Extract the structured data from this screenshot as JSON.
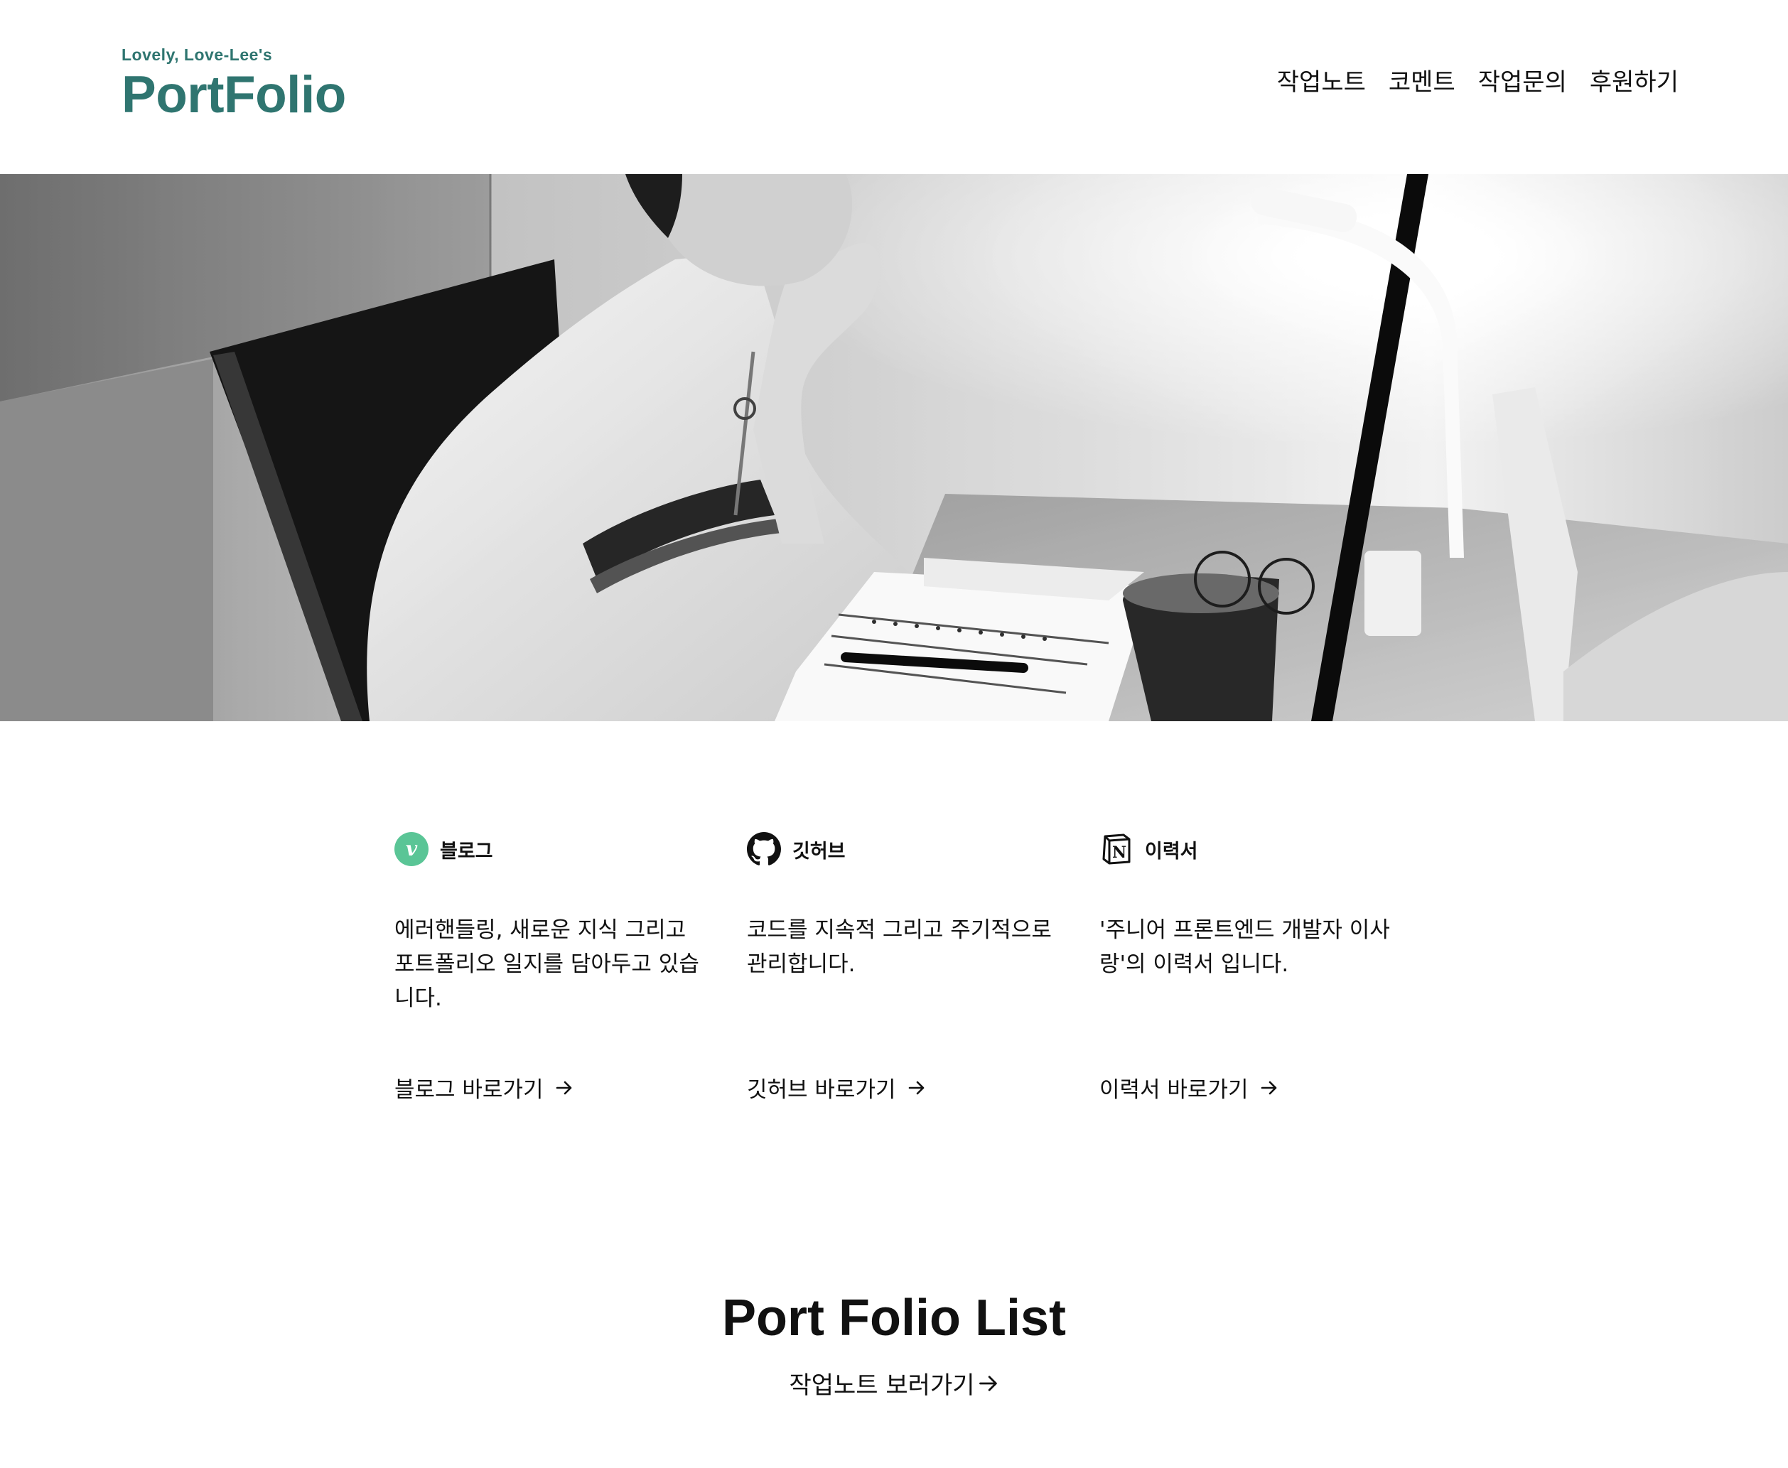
{
  "brand": {
    "tagline": "Lovely, Love-Lee's",
    "title": "PortFolio",
    "color": "#2f7570"
  },
  "nav": {
    "items": [
      {
        "label": "작업노트"
      },
      {
        "label": "코멘트"
      },
      {
        "label": "작업문의"
      },
      {
        "label": "후원하기"
      }
    ]
  },
  "cards": [
    {
      "icon": "velog-icon",
      "title": "블로그",
      "description": "에러핸들링, 새로운 지식 그리고 포트폴리오 일지를 담아두고 있습니다.",
      "link_label": "블로그 바로가기"
    },
    {
      "icon": "github-icon",
      "title": "깃허브",
      "description": "코드를 지속적 그리고 주기적으로 관리합니다.",
      "link_label": "깃허브 바로가기"
    },
    {
      "icon": "notion-icon",
      "title": "이력서",
      "description": "'주니어 프론트엔드 개발자 이사랑'의 이력서 입니다.",
      "link_label": "이력서 바로가기"
    }
  ],
  "portfolio_list": {
    "title": "Port Folio List",
    "link_label": "작업노트 보러가기"
  },
  "colors": {
    "accent": "#2f7570",
    "velog": "#5ac596"
  }
}
